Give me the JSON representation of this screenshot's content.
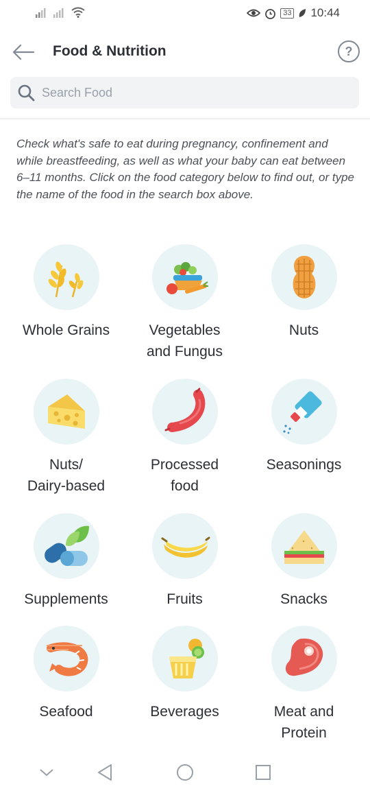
{
  "status_bar": {
    "battery": "33",
    "time": "10:44"
  },
  "header": {
    "title": "Food & Nutrition",
    "help_symbol": "?"
  },
  "search": {
    "placeholder": "Search Food",
    "value": ""
  },
  "intro": "Check what's safe to eat during pregnancy, confinement and while breastfeeding, as well as what your baby can eat between 6–11 months. Click on the food category below to find out, or type the name of the food in the search box above.",
  "categories": [
    {
      "label_line1": "Whole Grains",
      "label_line2": "",
      "icon": "wheat-icon"
    },
    {
      "label_line1": "Vegetables",
      "label_line2": "and Fungus",
      "icon": "vegetable-basket-icon"
    },
    {
      "label_line1": "Nuts",
      "label_line2": "",
      "icon": "peanut-icon"
    },
    {
      "label_line1": "Nuts/",
      "label_line2": "Dairy-based",
      "icon": "cheese-icon"
    },
    {
      "label_line1": "Processed",
      "label_line2": "food",
      "icon": "sausage-icon"
    },
    {
      "label_line1": "Seasonings",
      "label_line2": "",
      "icon": "salt-shaker-icon"
    },
    {
      "label_line1": "Supplements",
      "label_line2": "",
      "icon": "pills-icon"
    },
    {
      "label_line1": "Fruits",
      "label_line2": "",
      "icon": "banana-icon"
    },
    {
      "label_line1": "Snacks",
      "label_line2": "",
      "icon": "sandwich-icon"
    },
    {
      "label_line1": "Seafood",
      "label_line2": "",
      "icon": "shrimp-icon"
    },
    {
      "label_line1": "Beverages",
      "label_line2": "",
      "icon": "drink-glass-icon"
    },
    {
      "label_line1": "Meat and",
      "label_line2": "Protein",
      "icon": "meat-steak-icon"
    }
  ],
  "nav_bar": {
    "icons": [
      "collapse-chevron-icon",
      "back-triangle-icon",
      "home-circle-icon",
      "recents-square-icon"
    ]
  }
}
